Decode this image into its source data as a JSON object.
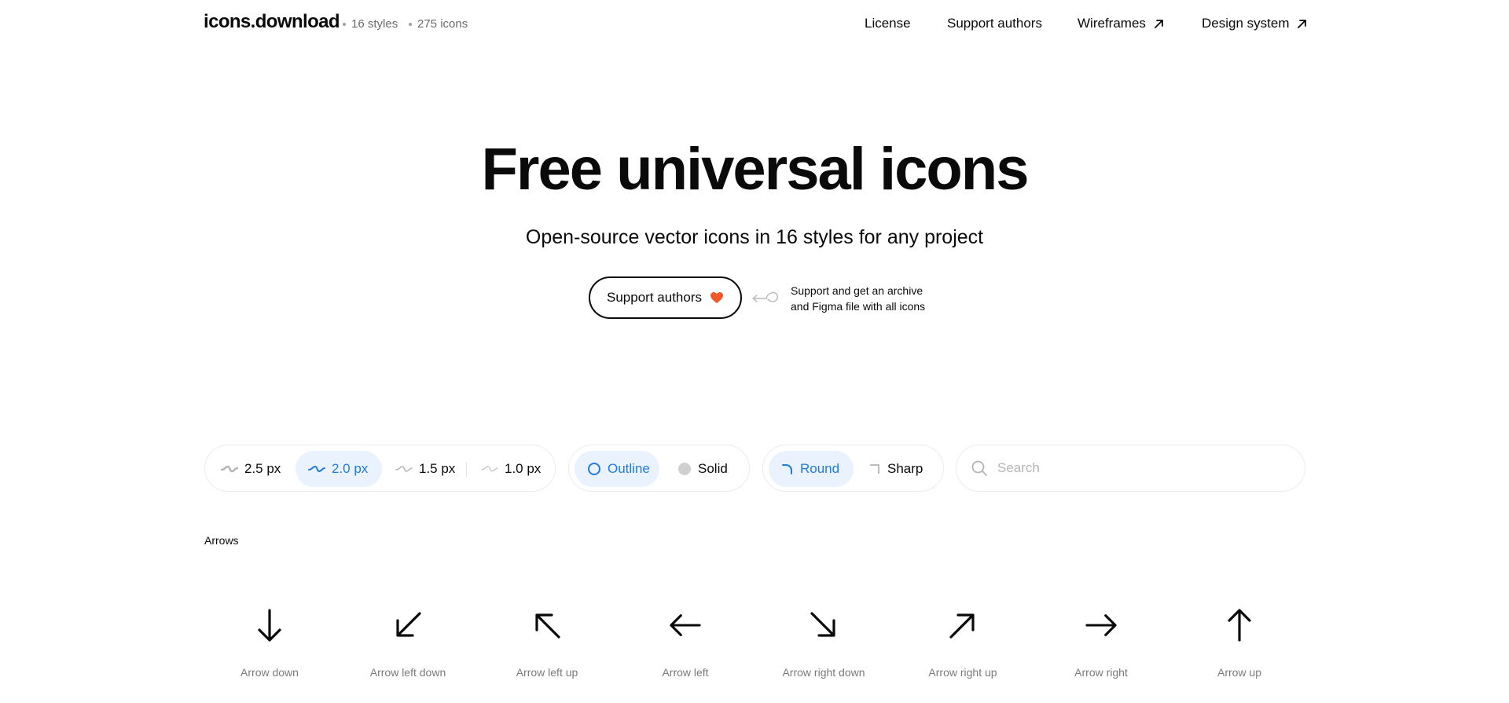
{
  "header": {
    "logo": "icons.download",
    "styles_count": "16 styles",
    "icons_count": "275 icons",
    "nav": [
      {
        "label": "License",
        "external": false
      },
      {
        "label": "Support authors",
        "external": false
      },
      {
        "label": "Wireframes",
        "external": true
      },
      {
        "label": "Design system",
        "external": true
      }
    ]
  },
  "hero": {
    "title": "Free universal icons",
    "subtitle": "Open-source vector icons in 16 styles for any project",
    "support_button": "Support authors",
    "support_note_line1": "Support and get an archive",
    "support_note_line2": "and Figma file with all icons"
  },
  "filters": {
    "stroke": {
      "options": [
        "2.5 px",
        "2.0 px",
        "1.5 px",
        "1.0 px"
      ],
      "selected": "2.0 px"
    },
    "fill": {
      "options": [
        "Outline",
        "Solid"
      ],
      "selected": "Outline"
    },
    "corner": {
      "options": [
        "Round",
        "Sharp"
      ],
      "selected": "Round"
    },
    "search": {
      "placeholder": "Search",
      "value": ""
    }
  },
  "section": {
    "title": "Arrows",
    "icons": [
      {
        "label": "Arrow down",
        "icon": "arrow-down-icon"
      },
      {
        "label": "Arrow left down",
        "icon": "arrow-left-down-icon"
      },
      {
        "label": "Arrow left up",
        "icon": "arrow-left-up-icon"
      },
      {
        "label": "Arrow left",
        "icon": "arrow-left-icon"
      },
      {
        "label": "Arrow right down",
        "icon": "arrow-right-down-icon"
      },
      {
        "label": "Arrow right up",
        "icon": "arrow-right-up-icon"
      },
      {
        "label": "Arrow right",
        "icon": "arrow-right-icon"
      },
      {
        "label": "Arrow up",
        "icon": "arrow-up-icon"
      }
    ]
  },
  "colors": {
    "accent": "#1f7ae0",
    "accent_bg": "#eaf3fd",
    "heart": "#f0582a",
    "text": "#0a0a0a",
    "muted": "#7a7a7a"
  }
}
